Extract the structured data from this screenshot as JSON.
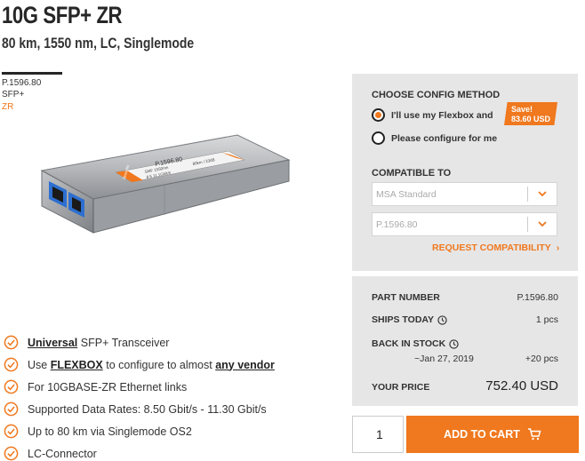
{
  "product": {
    "title": "10G SFP+ ZR",
    "subtitle": "80 km, 1550 nm, LC, Singlemode",
    "sku": "P.1596.80",
    "type_tag": "SFP+",
    "range_tag": "ZR",
    "label_lines": [
      "P.1596.80",
      "SMF 1550nm",
      "8.5 11.1Gbit/s",
      "80km / 23dB",
      "flexoptix"
    ]
  },
  "features": [
    {
      "prefix": "",
      "bold": "Universal",
      "mid": " SFP+ Transceiver",
      "bold2": "",
      "suffix": ""
    },
    {
      "prefix": "Use ",
      "bold": "FLEXBOX",
      "mid": " to configure to almost ",
      "bold2": "any vendor",
      "suffix": ""
    },
    {
      "prefix": "For 10GBASE-ZR Ethernet links",
      "bold": "",
      "mid": "",
      "bold2": "",
      "suffix": ""
    },
    {
      "prefix": "Supported Data Rates: 8.50 Gbit/s - 11.30 Gbit/s",
      "bold": "",
      "mid": "",
      "bold2": "",
      "suffix": ""
    },
    {
      "prefix": "Up to 80 km via Singlemode OS2",
      "bold": "",
      "mid": "",
      "bold2": "",
      "suffix": ""
    },
    {
      "prefix": "LC-Connector",
      "bold": "",
      "mid": "",
      "bold2": "",
      "suffix": ""
    }
  ],
  "config": {
    "heading": "CHOOSE CONFIG METHOD",
    "option_flexbox": "I'll use my Flexbox and",
    "option_configure": "Please configure for me",
    "save_label": "Save!",
    "save_amount": "83.60 USD",
    "compatible_heading": "COMPATIBLE TO",
    "compat_select": "MSA Standard",
    "sku_select": "P.1596.80",
    "request_link": "REQUEST COMPATIBILITY",
    "request_arrow": "›"
  },
  "info": {
    "part_label": "PART NUMBER",
    "part_value": "P.1596.80",
    "ships_label": "SHIPS TODAY",
    "ships_value": "1 pcs",
    "stock_label": "BACK IN STOCK",
    "stock_date": "~Jan 27, 2019",
    "stock_value": "+20 pcs",
    "price_label": "YOUR PRICE",
    "price_value": "752.40 USD"
  },
  "cart": {
    "quantity": "1",
    "button_label": "ADD TO CART"
  },
  "colors": {
    "accent": "#f0781e",
    "panel": "#e6e6e6"
  }
}
